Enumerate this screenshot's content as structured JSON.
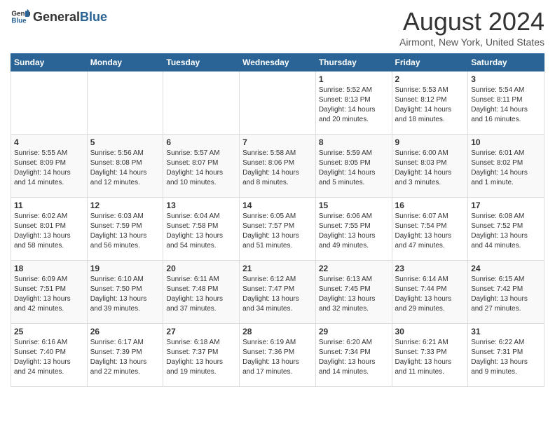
{
  "header": {
    "logo_general": "General",
    "logo_blue": "Blue",
    "month_year": "August 2024",
    "location": "Airmont, New York, United States"
  },
  "days_of_week": [
    "Sunday",
    "Monday",
    "Tuesday",
    "Wednesday",
    "Thursday",
    "Friday",
    "Saturday"
  ],
  "weeks": [
    [
      {
        "day": "",
        "content": ""
      },
      {
        "day": "",
        "content": ""
      },
      {
        "day": "",
        "content": ""
      },
      {
        "day": "",
        "content": ""
      },
      {
        "day": "1",
        "content": "Sunrise: 5:52 AM\nSunset: 8:13 PM\nDaylight: 14 hours and 20 minutes."
      },
      {
        "day": "2",
        "content": "Sunrise: 5:53 AM\nSunset: 8:12 PM\nDaylight: 14 hours and 18 minutes."
      },
      {
        "day": "3",
        "content": "Sunrise: 5:54 AM\nSunset: 8:11 PM\nDaylight: 14 hours and 16 minutes."
      }
    ],
    [
      {
        "day": "4",
        "content": "Sunrise: 5:55 AM\nSunset: 8:09 PM\nDaylight: 14 hours and 14 minutes."
      },
      {
        "day": "5",
        "content": "Sunrise: 5:56 AM\nSunset: 8:08 PM\nDaylight: 14 hours and 12 minutes."
      },
      {
        "day": "6",
        "content": "Sunrise: 5:57 AM\nSunset: 8:07 PM\nDaylight: 14 hours and 10 minutes."
      },
      {
        "day": "7",
        "content": "Sunrise: 5:58 AM\nSunset: 8:06 PM\nDaylight: 14 hours and 8 minutes."
      },
      {
        "day": "8",
        "content": "Sunrise: 5:59 AM\nSunset: 8:05 PM\nDaylight: 14 hours and 5 minutes."
      },
      {
        "day": "9",
        "content": "Sunrise: 6:00 AM\nSunset: 8:03 PM\nDaylight: 14 hours and 3 minutes."
      },
      {
        "day": "10",
        "content": "Sunrise: 6:01 AM\nSunset: 8:02 PM\nDaylight: 14 hours and 1 minute."
      }
    ],
    [
      {
        "day": "11",
        "content": "Sunrise: 6:02 AM\nSunset: 8:01 PM\nDaylight: 13 hours and 58 minutes."
      },
      {
        "day": "12",
        "content": "Sunrise: 6:03 AM\nSunset: 7:59 PM\nDaylight: 13 hours and 56 minutes."
      },
      {
        "day": "13",
        "content": "Sunrise: 6:04 AM\nSunset: 7:58 PM\nDaylight: 13 hours and 54 minutes."
      },
      {
        "day": "14",
        "content": "Sunrise: 6:05 AM\nSunset: 7:57 PM\nDaylight: 13 hours and 51 minutes."
      },
      {
        "day": "15",
        "content": "Sunrise: 6:06 AM\nSunset: 7:55 PM\nDaylight: 13 hours and 49 minutes."
      },
      {
        "day": "16",
        "content": "Sunrise: 6:07 AM\nSunset: 7:54 PM\nDaylight: 13 hours and 47 minutes."
      },
      {
        "day": "17",
        "content": "Sunrise: 6:08 AM\nSunset: 7:52 PM\nDaylight: 13 hours and 44 minutes."
      }
    ],
    [
      {
        "day": "18",
        "content": "Sunrise: 6:09 AM\nSunset: 7:51 PM\nDaylight: 13 hours and 42 minutes."
      },
      {
        "day": "19",
        "content": "Sunrise: 6:10 AM\nSunset: 7:50 PM\nDaylight: 13 hours and 39 minutes."
      },
      {
        "day": "20",
        "content": "Sunrise: 6:11 AM\nSunset: 7:48 PM\nDaylight: 13 hours and 37 minutes."
      },
      {
        "day": "21",
        "content": "Sunrise: 6:12 AM\nSunset: 7:47 PM\nDaylight: 13 hours and 34 minutes."
      },
      {
        "day": "22",
        "content": "Sunrise: 6:13 AM\nSunset: 7:45 PM\nDaylight: 13 hours and 32 minutes."
      },
      {
        "day": "23",
        "content": "Sunrise: 6:14 AM\nSunset: 7:44 PM\nDaylight: 13 hours and 29 minutes."
      },
      {
        "day": "24",
        "content": "Sunrise: 6:15 AM\nSunset: 7:42 PM\nDaylight: 13 hours and 27 minutes."
      }
    ],
    [
      {
        "day": "25",
        "content": "Sunrise: 6:16 AM\nSunset: 7:40 PM\nDaylight: 13 hours and 24 minutes."
      },
      {
        "day": "26",
        "content": "Sunrise: 6:17 AM\nSunset: 7:39 PM\nDaylight: 13 hours and 22 minutes."
      },
      {
        "day": "27",
        "content": "Sunrise: 6:18 AM\nSunset: 7:37 PM\nDaylight: 13 hours and 19 minutes."
      },
      {
        "day": "28",
        "content": "Sunrise: 6:19 AM\nSunset: 7:36 PM\nDaylight: 13 hours and 17 minutes."
      },
      {
        "day": "29",
        "content": "Sunrise: 6:20 AM\nSunset: 7:34 PM\nDaylight: 13 hours and 14 minutes."
      },
      {
        "day": "30",
        "content": "Sunrise: 6:21 AM\nSunset: 7:33 PM\nDaylight: 13 hours and 11 minutes."
      },
      {
        "day": "31",
        "content": "Sunrise: 6:22 AM\nSunset: 7:31 PM\nDaylight: 13 hours and 9 minutes."
      }
    ]
  ]
}
